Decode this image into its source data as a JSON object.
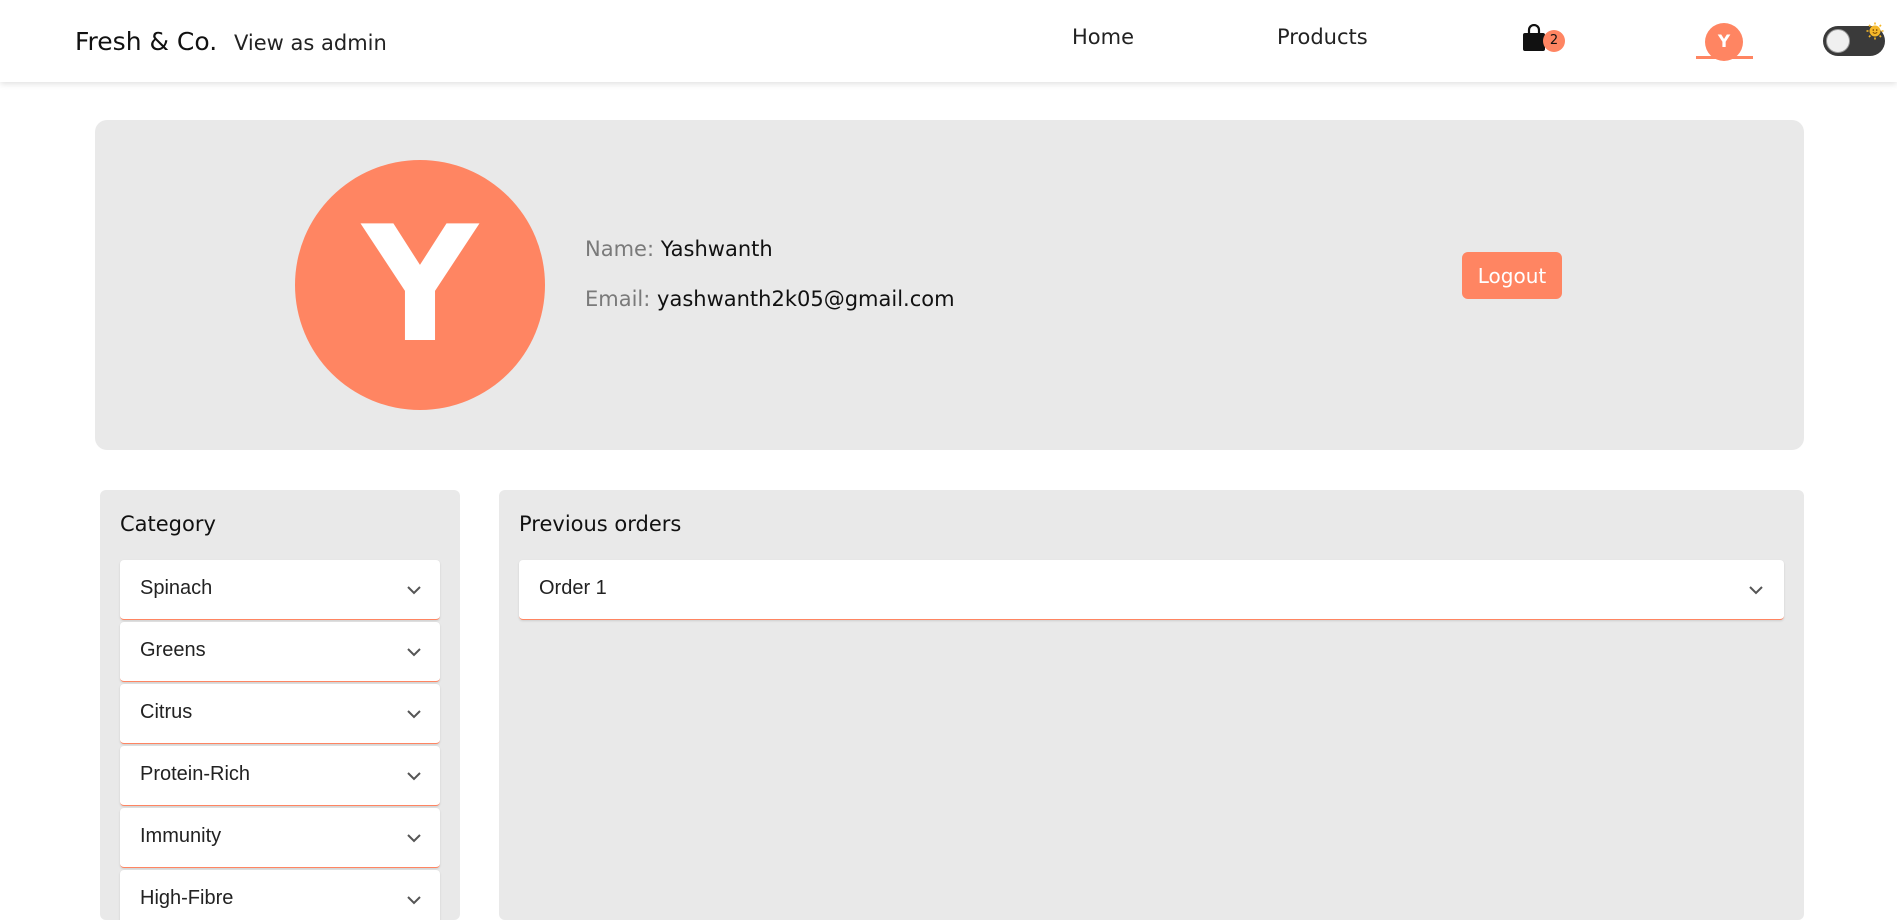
{
  "header": {
    "brand": "Fresh & Co.",
    "admin_link": "View as admin",
    "nav": {
      "home": "Home",
      "products": "Products"
    },
    "cart_count": "2",
    "avatar_initial": "Y",
    "theme_toggle_icon": "sun-icon"
  },
  "profile": {
    "avatar_initial": "Y",
    "name_label": "Name:",
    "name_value": "Yashwanth",
    "email_label": "Email:",
    "email_value": "yashwanth2k05@gmail.com",
    "logout_label": "Logout"
  },
  "categories": {
    "title": "Category",
    "items": [
      {
        "label": "Spinach"
      },
      {
        "label": "Greens"
      },
      {
        "label": "Citrus"
      },
      {
        "label": "Protein-Rich"
      },
      {
        "label": "Immunity"
      },
      {
        "label": "High-Fibre"
      }
    ]
  },
  "orders": {
    "title": "Previous orders",
    "items": [
      {
        "label": "Order 1"
      }
    ]
  },
  "colors": {
    "accent": "#ff8562",
    "panel_bg": "#e9e9e9",
    "toggle_bg": "#3a3a3a"
  }
}
